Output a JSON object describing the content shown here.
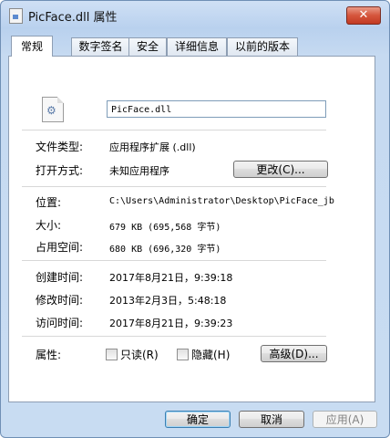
{
  "window": {
    "title": "PicFace.dll 属性",
    "close_label": "✕"
  },
  "tabs": [
    {
      "label": "常规",
      "active": true
    },
    {
      "label": "数字签名",
      "active": false
    },
    {
      "label": "安全",
      "active": false
    },
    {
      "label": "详细信息",
      "active": false
    },
    {
      "label": "以前的版本",
      "active": false
    }
  ],
  "general": {
    "file_name": "PicFace.dll",
    "file_type_label": "文件类型:",
    "file_type_value": "应用程序扩展 (.dll)",
    "open_with_label": "打开方式:",
    "open_with_value": "未知应用程序",
    "change_button": "更改(C)...",
    "location_label": "位置:",
    "location_value": "C:\\Users\\Administrator\\Desktop\\PicFace_jb",
    "size_label": "大小:",
    "size_value": "679 KB (695,568 字节)",
    "size_on_disk_label": "占用空间:",
    "size_on_disk_value": "680 KB (696,320 字节)",
    "created_label": "创建时间:",
    "created_value": "2017年8月21日，9:39:18",
    "modified_label": "修改时间:",
    "modified_value": "2013年2月3日，5:48:18",
    "accessed_label": "访问时间:",
    "accessed_value": "2017年8月21日，9:39:23",
    "attributes_label": "属性:",
    "readonly_label": "只读(R)",
    "hidden_label": "隐藏(H)",
    "advanced_button": "高级(D)..."
  },
  "footer": {
    "ok": "确定",
    "cancel": "取消",
    "apply": "应用(A)"
  }
}
